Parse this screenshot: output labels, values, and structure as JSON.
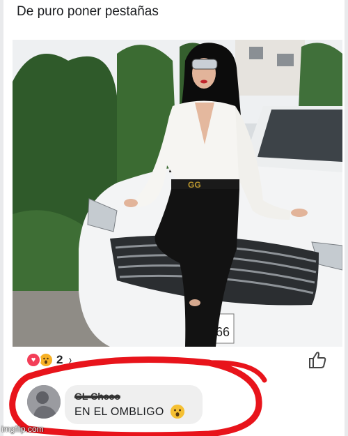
{
  "post": {
    "text": "De puro poner pestañas"
  },
  "photo": {
    "plate_text": "-66"
  },
  "reactions": {
    "types": [
      "love-reaction-icon",
      "wow-reaction-icon"
    ],
    "count": "2",
    "chevron": "›"
  },
  "comment": {
    "author": "GL Checo",
    "text": "EN EL OMBLIGO"
  },
  "watermark": "imgflip.com",
  "colors": {
    "highlight_circle": "#e8141b",
    "love": "#f33e58",
    "wow": "#f7b125"
  }
}
